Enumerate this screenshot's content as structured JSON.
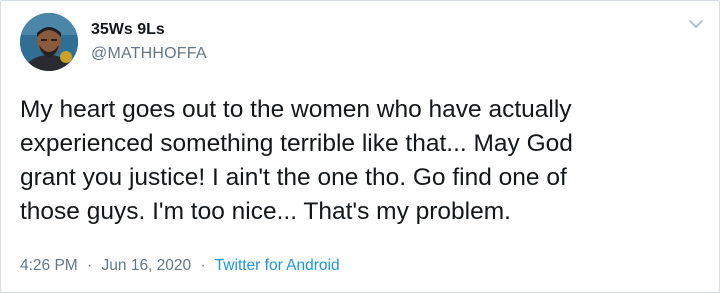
{
  "author": {
    "display_name": "35Ws 9Ls",
    "handle": "@MATHHOFFA"
  },
  "icons": {
    "avatar": "user-avatar-photo",
    "menu": "chevron-down-icon"
  },
  "tweet": {
    "lines": [
      "My heart goes out to the women who have actually",
      "experienced something terrible like that... May God",
      "grant you justice! I ain't the one tho. Go find one of",
      "those guys. I'm too nice... That's my problem."
    ]
  },
  "meta": {
    "time": "4:26 PM",
    "separator": "·",
    "date": "Jun 16, 2020",
    "source": "Twitter for Android"
  },
  "colors": {
    "text": "#14171a",
    "secondary": "#657786",
    "link": "#1b95e0",
    "border": "#d6dde3"
  }
}
